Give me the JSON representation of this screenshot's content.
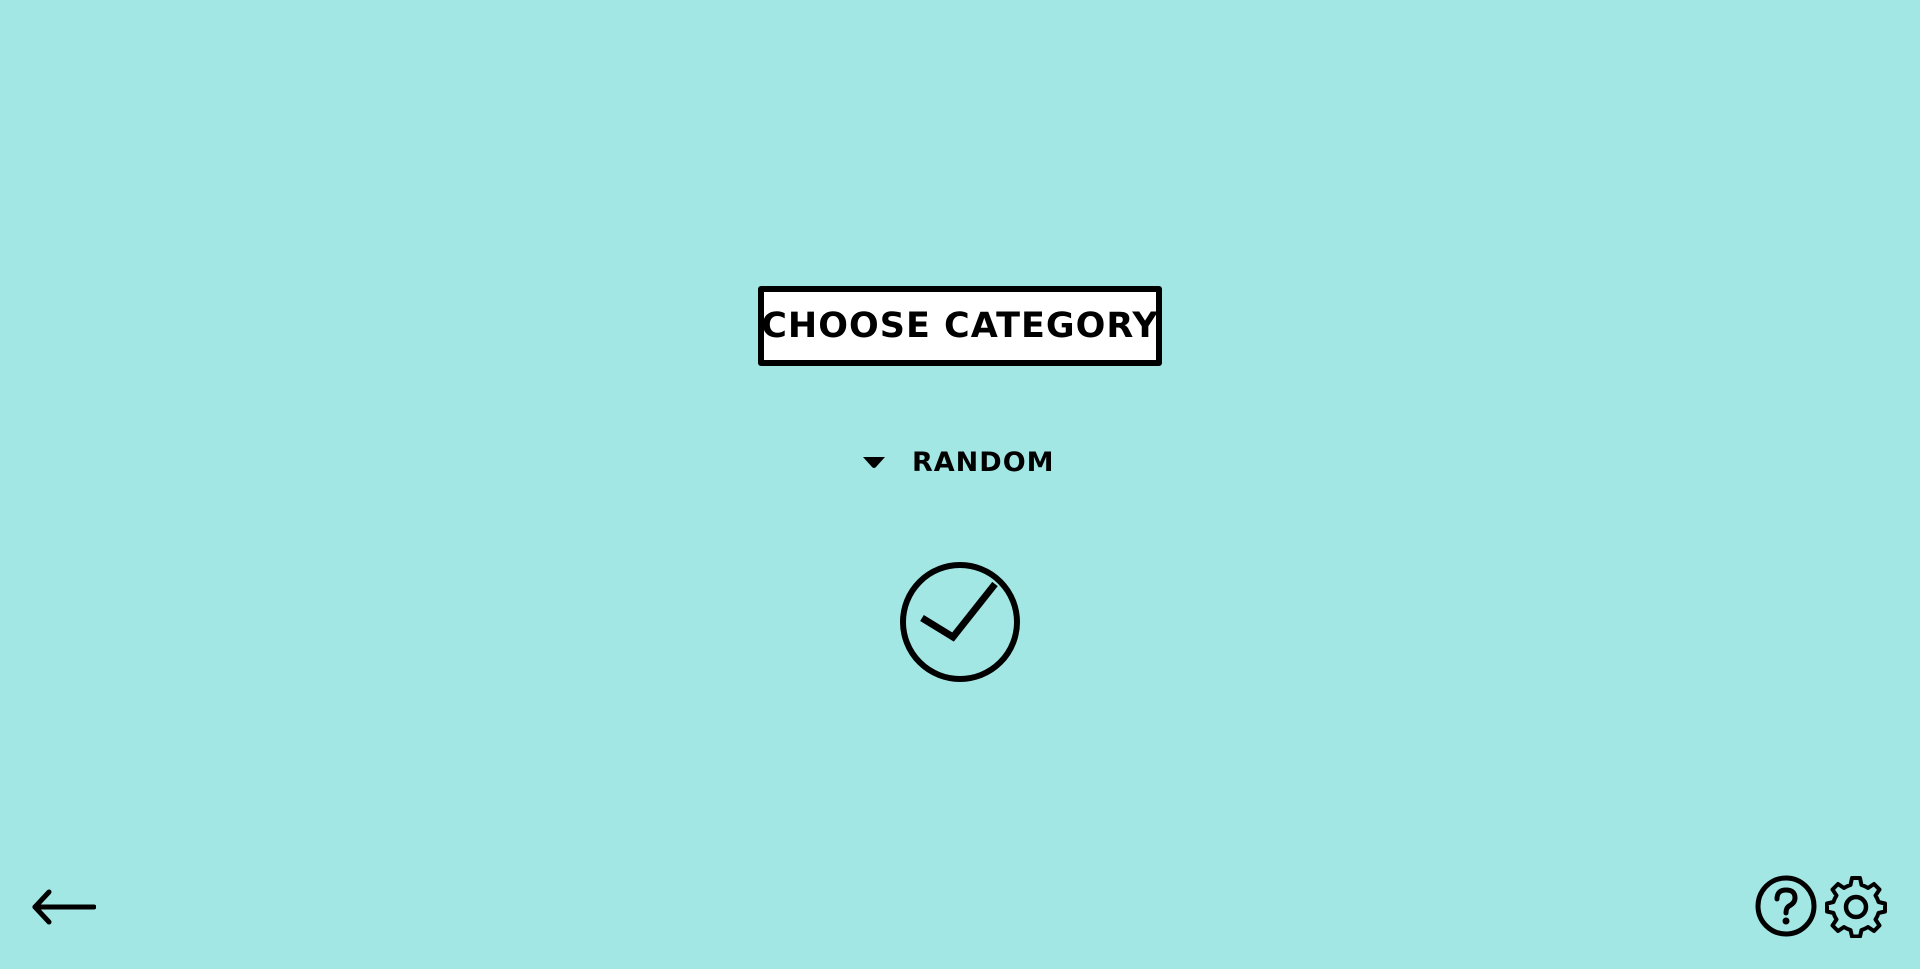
{
  "screen": {
    "title": "CHOOSE CATEGORY",
    "background_color": "#a3e7e4"
  },
  "category_select": {
    "selected_value": "RANDOM",
    "caret_icon": "caret-down-icon"
  },
  "controls": {
    "confirm_icon": "check-circle-icon",
    "back_icon": "arrow-left-icon",
    "help_icon": "question-circle-icon",
    "settings_icon": "gear-icon"
  }
}
